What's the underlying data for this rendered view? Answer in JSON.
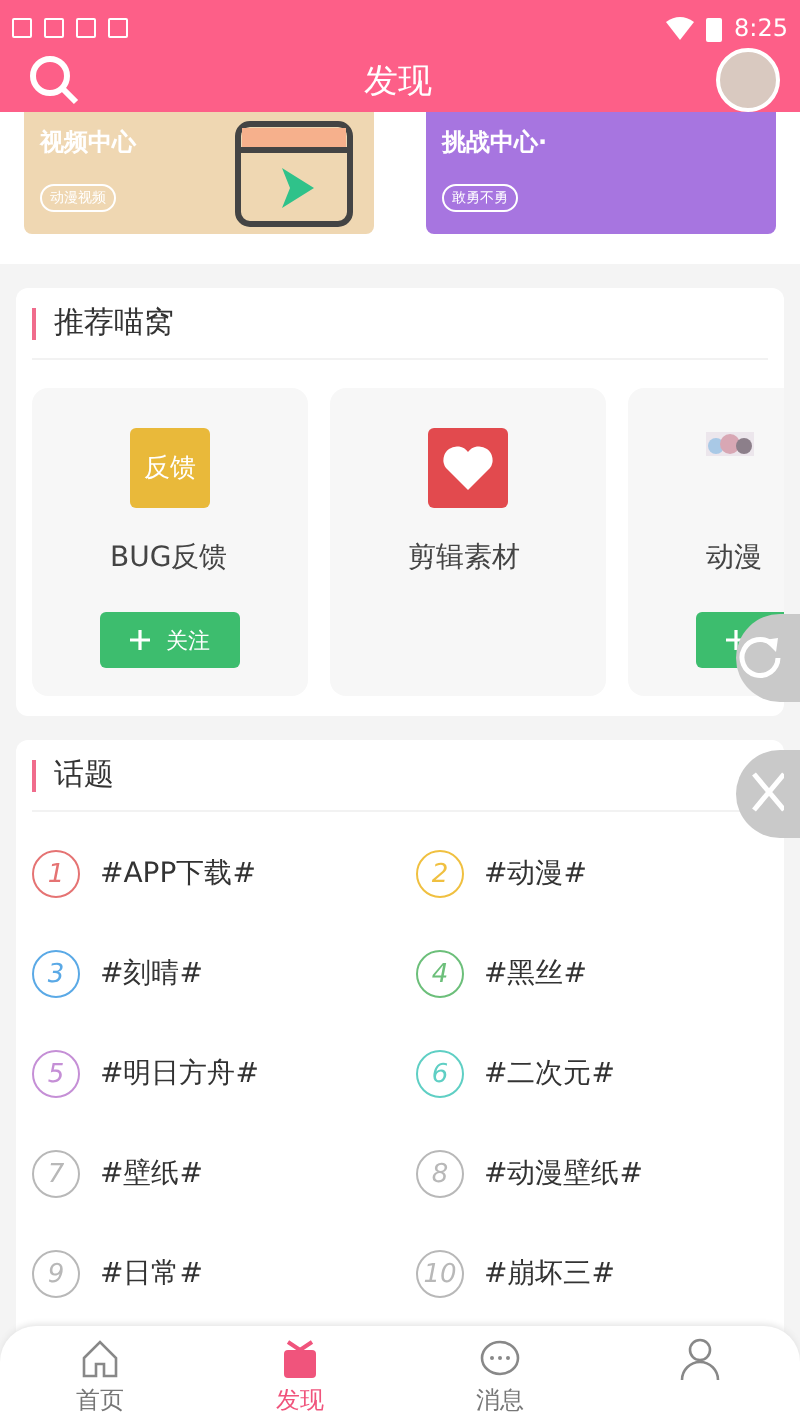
{
  "status_bar": {
    "time": "8:25"
  },
  "header": {
    "title": "发现"
  },
  "banners": [
    {
      "title": "视频中心",
      "tag": "动漫视频",
      "kind": "video"
    },
    {
      "title": "挑战中心·",
      "tag": "敢勇不勇",
      "kind": "challenge"
    }
  ],
  "recommend": {
    "title": "推荐喵窝",
    "items": [
      {
        "name": "BUG反馈",
        "kind": "text-logo",
        "logo": "反馈",
        "button": "关注"
      },
      {
        "name": "剪辑素材",
        "kind": "heart-logo"
      },
      {
        "name": "动漫",
        "kind": "picture-logo",
        "follow_button": true
      }
    ]
  },
  "topics": {
    "title": "话题",
    "items": [
      {
        "rank": "1",
        "label": "#APP下载#",
        "color": "#e57373"
      },
      {
        "rank": "2",
        "label": "#动漫#",
        "color": "#f0c040"
      },
      {
        "rank": "3",
        "label": "#刻晴#",
        "color": "#5aa9e6"
      },
      {
        "rank": "4",
        "label": "#黑丝#",
        "color": "#6cbf7a"
      },
      {
        "rank": "5",
        "label": "#明日方舟#",
        "color": "#c58fd6"
      },
      {
        "rank": "6",
        "label": "#二次元#",
        "color": "#5fcfc4"
      },
      {
        "rank": "7",
        "label": "#壁纸#",
        "color": "#b8b8b8"
      },
      {
        "rank": "8",
        "label": "#动漫壁纸#",
        "color": "#b8b8b8"
      },
      {
        "rank": "9",
        "label": "#日常#",
        "color": "#b8b8b8"
      },
      {
        "rank": "10",
        "label": "#崩坏三#",
        "color": "#b8b8b8"
      }
    ]
  },
  "bottom_nav": [
    {
      "label": "首页",
      "kind": "home",
      "selected": false
    },
    {
      "label": "发现",
      "kind": "gift",
      "selected": true
    },
    {
      "label": "消息",
      "kind": "chat",
      "selected": false
    },
    {
      "kind": "user",
      "selected": false
    }
  ]
}
